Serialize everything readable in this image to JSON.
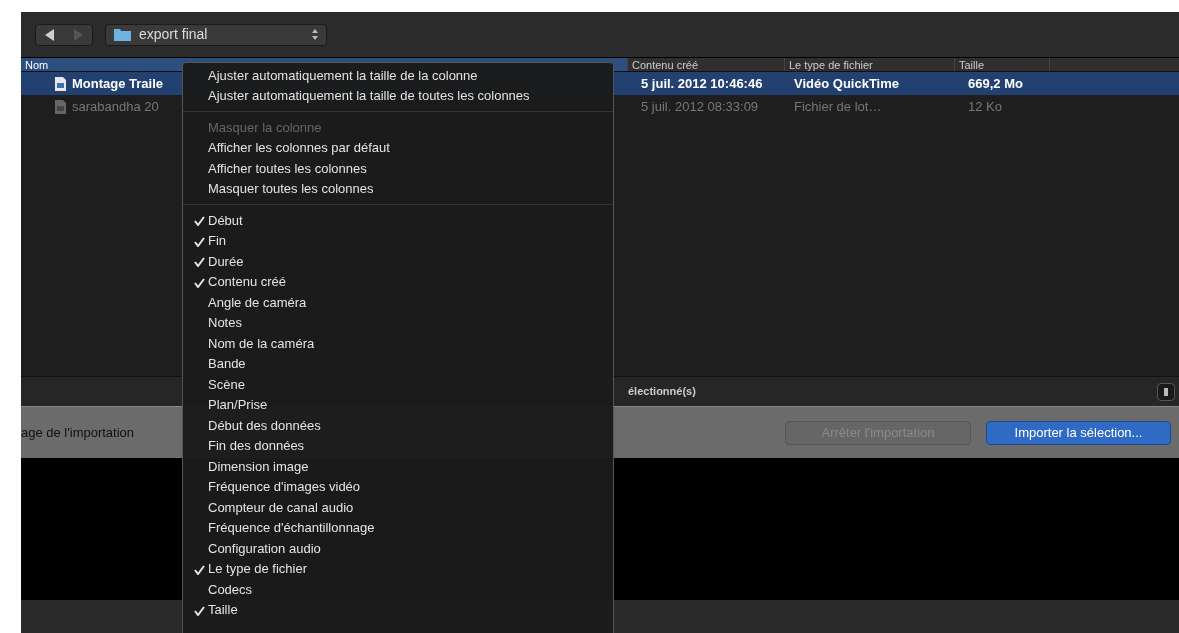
{
  "toolbar": {
    "folder": "export final"
  },
  "table": {
    "columns": [
      {
        "label": "Nom",
        "selected": true
      },
      {
        "label": "Contenu créé",
        "selected": false
      },
      {
        "label": "Le type de fichier",
        "selected": false
      },
      {
        "label": "Taille",
        "selected": false
      }
    ],
    "rows": [
      {
        "name": "Montage Traile",
        "created": "5 juil. 2012 10:46:46",
        "type": "Vidéo QuickTime",
        "size": "669,2 Mo",
        "selected": true
      },
      {
        "name": "sarabandha 20",
        "created": "5 juil. 2012 08:33:09",
        "type": "Fichier de lot…",
        "size": "12 Ko",
        "selected": false
      }
    ]
  },
  "status": "électionné(s)",
  "import_bar": {
    "label": "age de l'importation",
    "buttons": [
      {
        "label": "Arrêter l'importation",
        "disabled": true,
        "kind": "secondary"
      },
      {
        "label": "Importer la sélection...",
        "disabled": false,
        "kind": "primary"
      }
    ]
  },
  "menu": {
    "sections": [
      [
        {
          "label": "Ajuster automatiquement la taille de la colonne",
          "disabled": false
        },
        {
          "label": "Ajuster automatiquement la taille de toutes les colonnes",
          "disabled": false
        }
      ],
      [
        {
          "label": "Masquer la colonne",
          "disabled": true
        },
        {
          "label": "Afficher les colonnes par défaut",
          "disabled": false
        },
        {
          "label": "Afficher toutes les colonnes",
          "disabled": false
        },
        {
          "label": "Masquer toutes les colonnes",
          "disabled": false
        }
      ],
      [
        {
          "label": "Début",
          "checked": true
        },
        {
          "label": "Fin",
          "checked": true
        },
        {
          "label": "Durée",
          "checked": true
        },
        {
          "label": "Contenu créé",
          "checked": true
        },
        {
          "label": "Angle de caméra",
          "checked": false
        },
        {
          "label": "Notes",
          "checked": false
        },
        {
          "label": "Nom de la caméra",
          "checked": false
        },
        {
          "label": "Bande",
          "checked": false
        },
        {
          "label": "Scène",
          "checked": false
        },
        {
          "label": "Plan/Prise",
          "checked": false
        },
        {
          "label": "Début des données",
          "checked": false
        },
        {
          "label": "Fin des données",
          "checked": false
        },
        {
          "label": "Dimension image",
          "checked": false
        },
        {
          "label": "Fréquence d'images vidéo",
          "checked": false
        },
        {
          "label": "Compteur de canal audio",
          "checked": false
        },
        {
          "label": "Fréquence d'échantillonnage",
          "checked": false
        },
        {
          "label": "Configuration audio",
          "checked": false
        },
        {
          "label": "Le type de fichier",
          "checked": true
        },
        {
          "label": "Codecs",
          "checked": false
        },
        {
          "label": "Taille",
          "checked": true
        }
      ]
    ]
  }
}
